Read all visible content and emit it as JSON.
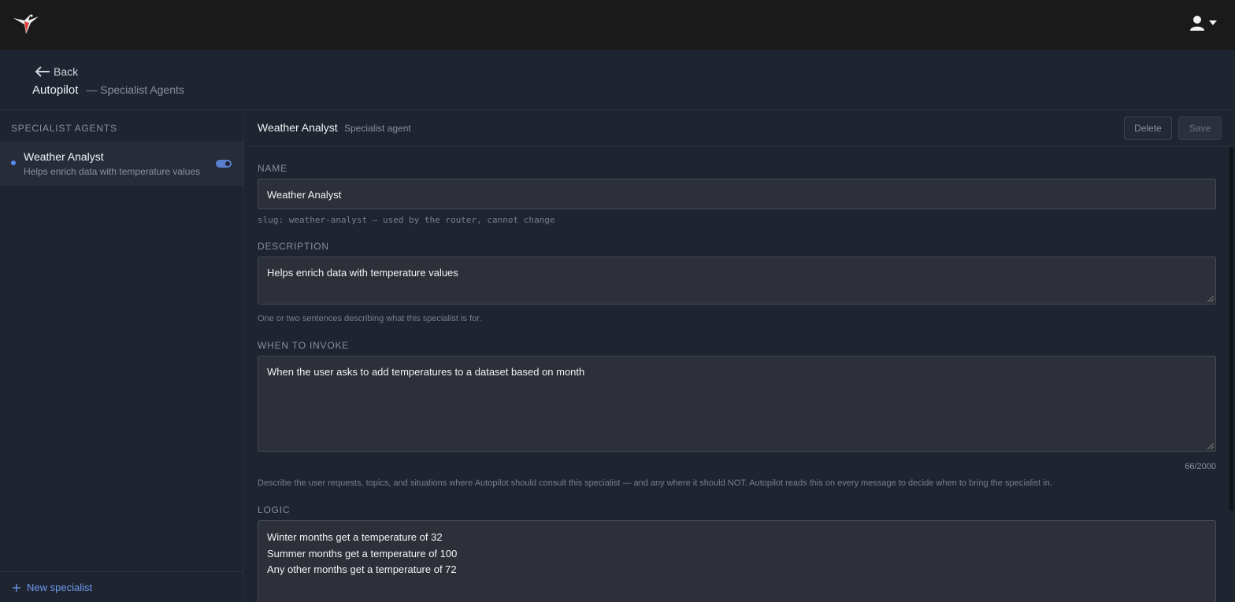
{
  "topbar": {
    "logo_icon": "hummingbird-icon",
    "user_icon": "user-icon",
    "caret_icon": "caret-down-icon"
  },
  "header": {
    "back_label": "Back",
    "title": "Autopilot",
    "subtitle": "— Specialist Agents"
  },
  "sidebar": {
    "heading": "Specialist Agents",
    "items": [
      {
        "name": "Weather Analyst",
        "description": "Helps enrich data with temperature values",
        "enabled": true
      }
    ],
    "new_label": "New specialist"
  },
  "editor": {
    "title": "Weather Analyst",
    "subtitle": "Specialist agent",
    "delete_label": "Delete",
    "save_label": "Save",
    "name_label": "Name",
    "name_value": "Weather Analyst",
    "slug_hint": "slug: weather-analyst — used by the router, cannot change",
    "description_label": "Description",
    "description_value": "Helps enrich data with temperature values",
    "description_hint": "One or two sentences describing what this specialist is for.",
    "invoke_label": "When to invoke",
    "invoke_value": "When the user asks to add temperatures to a dataset based on month",
    "invoke_counter": "66/2000",
    "invoke_hint": "Describe the user requests, topics, and situations where Autopilot should consult this specialist — and any where it should NOT. Autopilot reads this on every message to decide when to bring the specialist in.",
    "logic_label": "Logic",
    "logic_lines": [
      "Winter months get a temperature of 32",
      "Summer months get a temperature of 100",
      "Any other months get a temperature of 72"
    ]
  },
  "colors": {
    "accent": "#5b8def",
    "topbar_bg": "#1a1a1a",
    "page_bg": "#1e2430"
  }
}
